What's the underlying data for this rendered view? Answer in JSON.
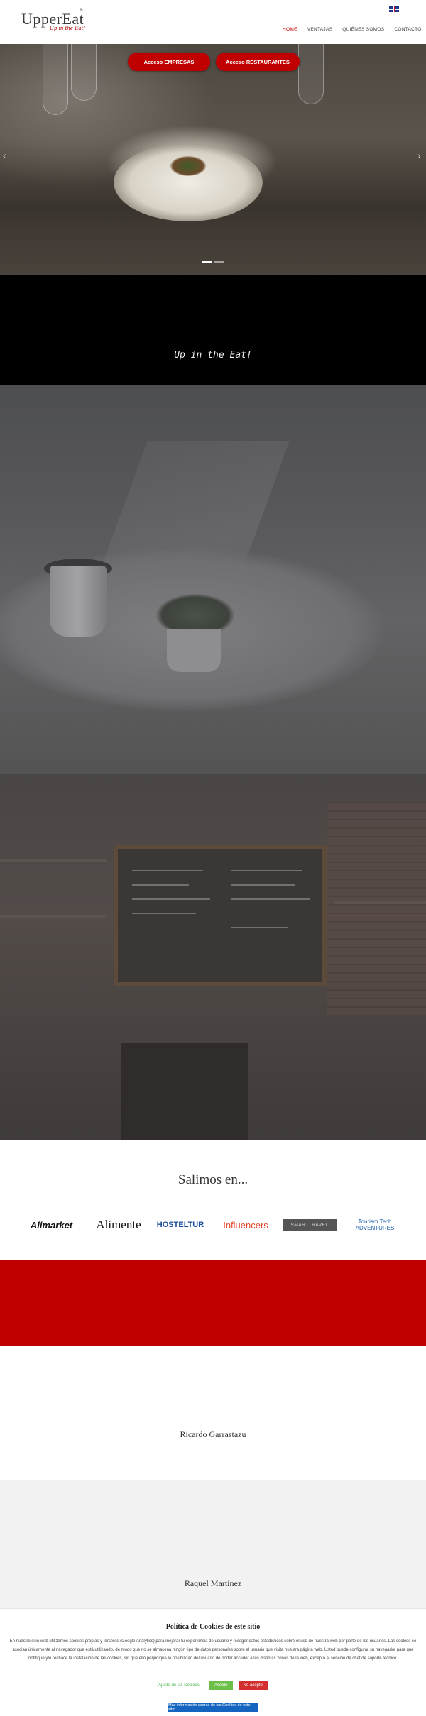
{
  "header": {
    "logo_text": "UpperEat",
    "logo_tagline": "Up in the Eat!",
    "logo_mark": "®",
    "language_icon": "uk-flag-icon",
    "nav": [
      {
        "label": "HOME",
        "active": true
      },
      {
        "label": "VENTAJAS",
        "active": false
      },
      {
        "label": "QUIÉNES SOMOS",
        "active": false
      },
      {
        "label": "CONTACTO",
        "active": false
      }
    ]
  },
  "hero": {
    "button_empresas": "Acceso EMPRESAS",
    "button_restaurantes": "Acceso RESTAURANTES",
    "prev_icon": "chevron-left-icon",
    "next_icon": "chevron-right-icon",
    "slide_count": 2,
    "active_slide": 1
  },
  "slogan": {
    "text": "Up in the Eat!"
  },
  "press": {
    "title": "Salimos en...",
    "logos": [
      {
        "name": "Alimarket"
      },
      {
        "name": "Alimente"
      },
      {
        "name": "HOSTELTUR"
      },
      {
        "name": "Influencers"
      },
      {
        "name": "SMARTTRAVEL"
      },
      {
        "name": "Tourism Tech ADVENTURES"
      }
    ]
  },
  "testimonials": [
    {
      "name": "Ricardo Garrastazu"
    },
    {
      "name": "Raquel Martínez"
    }
  ],
  "cookies": {
    "title": "Política de Cookies de este sitio",
    "text": "En nuestro sitio web utilizamos cookies propias y terceros (Google Analytics) para mejorar tu experiencia de usuario y recoger datos estadísticos sobre el uso de nuestra web por parte de los usuarios. Las cookies se asocian únicamente al navegador que está utilizando, de modo que no se almacena ningún tipo de datos personales sobre el usuario que visita nuestra página web. Usted puede configurar su navegador para que notifique y/o rechace la instalación de las cookies, sin que ello perjudique la posibilidad del usuario de poder acceder a las distintas zonas de la web, excepto al servicio de chat de soporte técnico.",
    "settings_link": "Ajuste de las Cookies",
    "accept": "Acepto",
    "reject": "No acepto",
    "more_info": "Más información acerca de las Cookies de este sitio"
  },
  "colors": {
    "brand_red": "#c00000",
    "nav_active": "#c40000",
    "cookie_accept": "#6cc04a",
    "cookie_reject": "#d32f2f",
    "cookie_more": "#1565c0"
  }
}
